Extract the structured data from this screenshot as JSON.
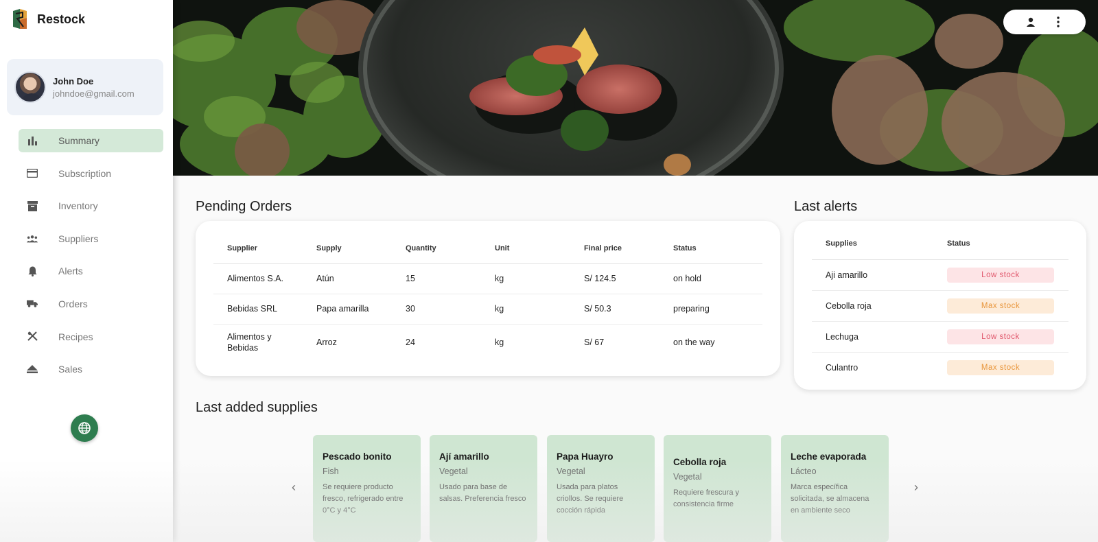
{
  "app": {
    "name": "Restock"
  },
  "user": {
    "name": "John Doe",
    "email": "johndoe@gmail.com"
  },
  "nav": [
    {
      "label": "Summary",
      "icon": "bar-chart-icon",
      "active": true
    },
    {
      "label": "Subscription",
      "icon": "credit-card-icon",
      "active": false
    },
    {
      "label": "Inventory",
      "icon": "archive-icon",
      "active": false
    },
    {
      "label": "Suppliers",
      "icon": "group-icon",
      "active": false
    },
    {
      "label": "Alerts",
      "icon": "bell-icon",
      "active": false
    },
    {
      "label": "Orders",
      "icon": "truck-icon",
      "active": false
    },
    {
      "label": "Recipes",
      "icon": "utensils-icon",
      "active": false
    },
    {
      "label": "Sales",
      "icon": "eject-icon",
      "active": false
    }
  ],
  "pending_orders": {
    "title": "Pending Orders",
    "columns": [
      "Supplier",
      "Supply",
      "Quantity",
      "Unit",
      "Final price",
      "Status"
    ],
    "rows": [
      [
        "Alimentos S.A.",
        "Atún",
        "15",
        "kg",
        "S/ 124.5",
        "on hold"
      ],
      [
        "Bebidas SRL",
        "Papa amarilla",
        "30",
        "kg",
        "S/ 50.3",
        "preparing"
      ],
      [
        "Alimentos y Bebidas",
        "Arroz",
        "24",
        "kg",
        "S/ 67",
        "on the way"
      ]
    ]
  },
  "last_alerts": {
    "title": "Last alerts",
    "columns": [
      "Supplies",
      "Status"
    ],
    "rows": [
      {
        "supply": "Aji amarillo",
        "status": "Low stock",
        "level": "low"
      },
      {
        "supply": "Cebolla roja",
        "status": "Max stock",
        "level": "max"
      },
      {
        "supply": "Lechuga",
        "status": "Low stock",
        "level": "low"
      },
      {
        "supply": "Culantro",
        "status": "Max stock",
        "level": "max"
      }
    ]
  },
  "last_supplies": {
    "title": "Last added supplies",
    "prev": "‹",
    "next": "›",
    "items": [
      {
        "name": "Pescado bonito",
        "category": "Fish",
        "description": "Se requiere producto fresco, refrigerado entre 0°C y 4°C"
      },
      {
        "name": "Ají amarillo",
        "category": "Vegetal",
        "description": "Usado para base de salsas. Preferencia fresco"
      },
      {
        "name": "Papa Huayro",
        "category": "Vegetal",
        "description": "Usada para platos criollos. Se requiere cocción rápida"
      },
      {
        "name": "Cebolla roja",
        "category": "Vegetal",
        "description": "Requiere frescura y consistencia firme"
      },
      {
        "name": "Leche evaporada",
        "category": "Lácteo",
        "description": "Marca específica solicitada, se almacena en ambiente seco"
      }
    ]
  },
  "colors": {
    "accent": "#2e7d4f",
    "active_nav": "#d4e9d8",
    "supply_card": "#cfe6d2",
    "low_stock_bg": "#fde4e6",
    "low_stock_text": "#e0566b",
    "max_stock_bg": "#fdebd8",
    "max_stock_text": "#e8953a"
  }
}
